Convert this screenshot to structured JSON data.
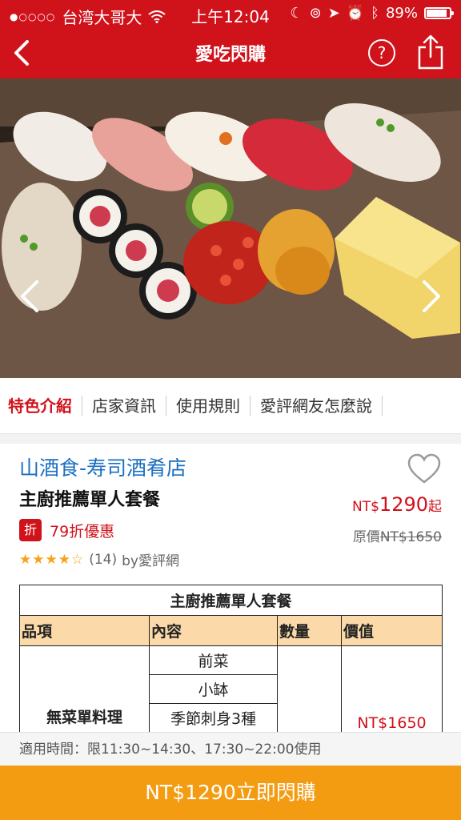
{
  "status_bar": {
    "signal": "●○○○○",
    "carrier": "台湾大哥大",
    "time": "上午12:04",
    "battery": "89%"
  },
  "nav": {
    "title": "愛吃閃購",
    "help_label": "?"
  },
  "tabs": [
    {
      "label": "特色介紹",
      "active": true
    },
    {
      "label": "店家資訊",
      "active": false
    },
    {
      "label": "使用規則",
      "active": false
    },
    {
      "label": "愛評網友怎麼說",
      "active": false
    }
  ],
  "deal": {
    "store_name": "山酒食-寿司酒肴店",
    "set_name": "主廚推薦單人套餐",
    "discount_badge": "折",
    "discount_text": "79折優惠",
    "price_currency": "NT$",
    "price_value": "1290",
    "price_suffix": "起",
    "original_label": "原價",
    "original_price": "NT$1650",
    "rating": 4.5,
    "rating_stars": "★★★★☆",
    "review_count": "(14)",
    "review_source": "by愛評網"
  },
  "menu_table": {
    "title": "主廚推薦單人套餐",
    "headers": [
      "品項",
      "內容",
      "數量",
      "價值"
    ],
    "category": "無菜單料理",
    "items": [
      "前菜",
      "小缽",
      "季節刺身3種"
    ],
    "value": "NT$1650"
  },
  "usage_time": "適用時間：限11:30~14:30、17:30~22:00使用",
  "buy_button": "NT$1290立即閃購",
  "colors": {
    "brand_red": "#d0121b",
    "buy_orange": "#f39c12",
    "link_blue": "#1a6fc0",
    "table_header": "#fbd9a8"
  }
}
